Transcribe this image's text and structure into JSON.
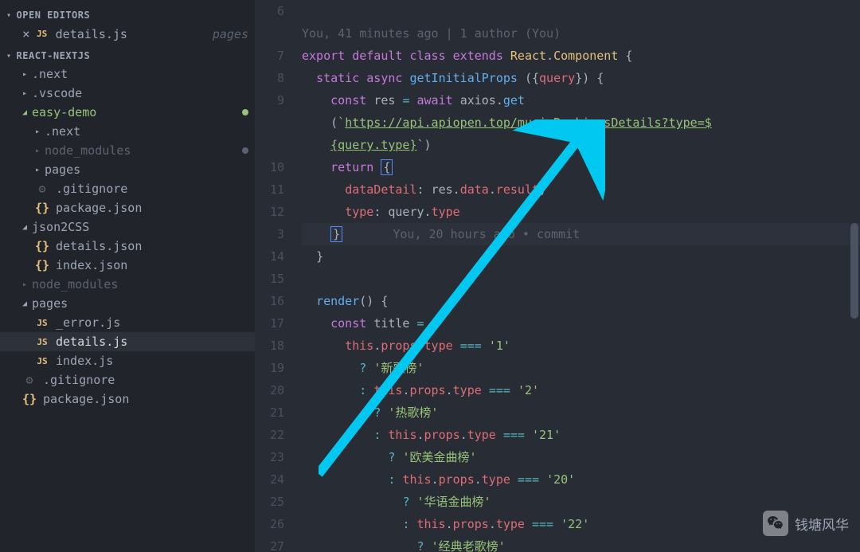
{
  "sidebar": {
    "open_editors_label": "OPEN EDITORS",
    "open_editor": {
      "name": "details.js",
      "folder": "pages"
    },
    "workspace_label": "REACT-NEXTJS",
    "tree": {
      "next": ".next",
      "vscode": ".vscode",
      "easydemo": "easy-demo",
      "easydemo_next": ".next",
      "easydemo_node_modules": "node_modules",
      "easydemo_pages": "pages",
      "easydemo_gitignore": ".gitignore",
      "easydemo_package": "package.json",
      "json2css": "json2CSS",
      "json2css_details": "details.json",
      "json2css_index": "index.json",
      "node_modules": "node_modules",
      "pages": "pages",
      "pages_error": "_error.js",
      "pages_details": "details.js",
      "pages_index": "index.js",
      "gitignore": ".gitignore",
      "package": "package.json"
    }
  },
  "editor": {
    "blame_top": "You, 41 minutes ago | 1 author (You)",
    "blame_inline": "You, 20 hours ago • commit",
    "gutter": [
      "6",
      "",
      "7",
      "8",
      "9",
      "",
      "",
      "10",
      "11",
      "12",
      "3",
      "14",
      "15",
      "16",
      "17",
      "18",
      "19",
      "20",
      "21",
      "22",
      "23",
      "24",
      "25",
      "26",
      "27"
    ],
    "tokens": {
      "export": "export",
      "default": "default",
      "class": "class",
      "extends": "extends",
      "react": "React",
      "component": "Component",
      "static": "static",
      "async": "async",
      "getInitialProps": "getInitialProps",
      "query": "query",
      "const": "const",
      "res": "res",
      "await": "await",
      "axios": "axios",
      "get": "get",
      "return": "return",
      "url1": "https://api.apiopen.top/musicRankingsDetails?type=$",
      "url2": "{query.type}",
      "dataDetail": "dataDetail",
      "data": "data",
      "result": "result",
      "type": "type",
      "render": "render",
      "title": "title",
      "this": "this",
      "props": "props",
      "v1": "'1'",
      "v2": "'2'",
      "v21": "'21'",
      "v20": "'20'",
      "v22": "'22'",
      "s1": "'新歌榜'",
      "s2": "'热歌榜'",
      "s3": "'欧美金曲榜'",
      "s4": "'华语金曲榜'",
      "s5": "'经典老歌榜'"
    }
  },
  "watermark": "钱塘风华"
}
